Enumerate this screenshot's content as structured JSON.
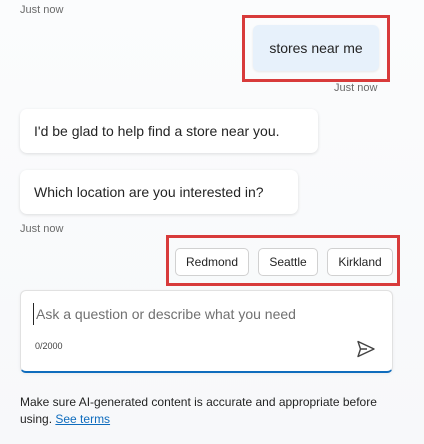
{
  "timestamps": {
    "first": "Just now",
    "user_message": "Just now",
    "suggestions": "Just now"
  },
  "user_message": {
    "text": "stores near me"
  },
  "bot_messages": [
    {
      "text": "I'd be glad to help find a store near you."
    },
    {
      "text": "Which location are you interested in?"
    }
  ],
  "suggestions": [
    {
      "label": "Redmond"
    },
    {
      "label": "Seattle"
    },
    {
      "label": "Kirkland"
    }
  ],
  "composer": {
    "placeholder": "Ask a question or describe what you need",
    "char_count": "0/2000",
    "send_icon": "send-icon"
  },
  "disclaimer": {
    "text": "Make sure AI-generated content is accurate and appropriate before using.",
    "link_label": "See terms"
  },
  "colors": {
    "highlight": "#d83b3b",
    "user_bubble": "#e7f1fb",
    "accent": "#0f6cbd"
  }
}
